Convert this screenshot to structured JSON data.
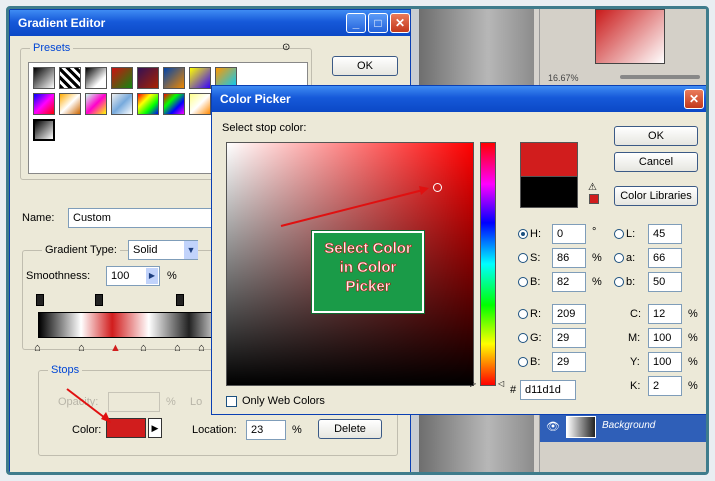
{
  "gradient_editor": {
    "title": "Gradient Editor",
    "presets_label": "Presets",
    "ok_label": "OK",
    "name_label": "Name:",
    "name_value": "Custom",
    "gradient_type_label": "Gradient Type:",
    "gradient_type_value": "Solid",
    "smoothness_label": "Smoothness:",
    "smoothness_value": "100",
    "smoothness_unit": "%",
    "stops_label": "Stops",
    "opacity_label": "Opacity:",
    "opacity_unit": "%",
    "location_label_faded": "Lo",
    "color_label": "Color:",
    "location_label": "Location:",
    "location_value": "23",
    "location_unit": "%",
    "delete_label": "Delete",
    "stop_color": "#d11d1d"
  },
  "color_picker": {
    "title": "Color Picker",
    "select_label": "Select stop color:",
    "ok_label": "OK",
    "cancel_label": "Cancel",
    "libraries_label": "Color Libraries",
    "only_web_label": "Only Web Colors",
    "new_color": "#d11d1d",
    "current_color": "#000000",
    "hsb": [
      {
        "label": "H:",
        "value": "0",
        "unit": "°",
        "selected": true
      },
      {
        "label": "S:",
        "value": "86",
        "unit": "%",
        "selected": false
      },
      {
        "label": "B:",
        "value": "82",
        "unit": "%",
        "selected": false
      }
    ],
    "rgb": [
      {
        "label": "R:",
        "value": "209"
      },
      {
        "label": "G:",
        "value": "29"
      },
      {
        "label": "B:",
        "value": "29"
      }
    ],
    "lab": [
      {
        "label": "L:",
        "value": "45"
      },
      {
        "label": "a:",
        "value": "66"
      },
      {
        "label": "b:",
        "value": "50"
      }
    ],
    "cmyk": [
      {
        "label": "C:",
        "value": "12",
        "unit": "%"
      },
      {
        "label": "M:",
        "value": "100",
        "unit": "%"
      },
      {
        "label": "Y:",
        "value": "100",
        "unit": "%"
      },
      {
        "label": "K:",
        "value": "2",
        "unit": "%"
      }
    ],
    "hash": "#",
    "hex_value": "d11d1d"
  },
  "annotation": {
    "line1": "Select Color",
    "line2": "in Color",
    "line3": "Picker"
  },
  "background_panel": {
    "zoom_text": "16.67%",
    "layer_name": "Background"
  }
}
